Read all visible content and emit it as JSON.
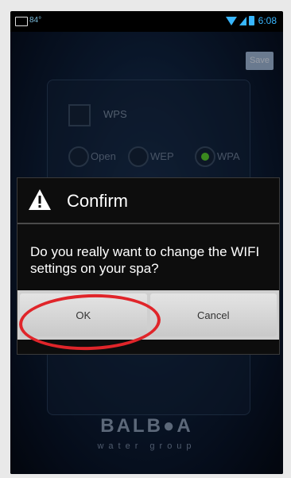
{
  "status_bar": {
    "left_text": "84°",
    "time": "6:08"
  },
  "app": {
    "save_label": "Save",
    "wps_label": "WPS",
    "security_options": [
      {
        "label": "Open",
        "selected": false
      },
      {
        "label": "WEP",
        "selected": false
      },
      {
        "label": "WPA",
        "selected": true
      }
    ],
    "logo_main": "BALB●A",
    "logo_sub": "water group"
  },
  "dialog": {
    "title": "Confirm",
    "message": "Do you really want to change the WIFI settings on your spa?",
    "ok_label": "OK",
    "cancel_label": "Cancel"
  },
  "colors": {
    "accent_blue": "#38b6ff",
    "highlight_red": "#e0252a",
    "selected_green": "#5ad12f"
  }
}
